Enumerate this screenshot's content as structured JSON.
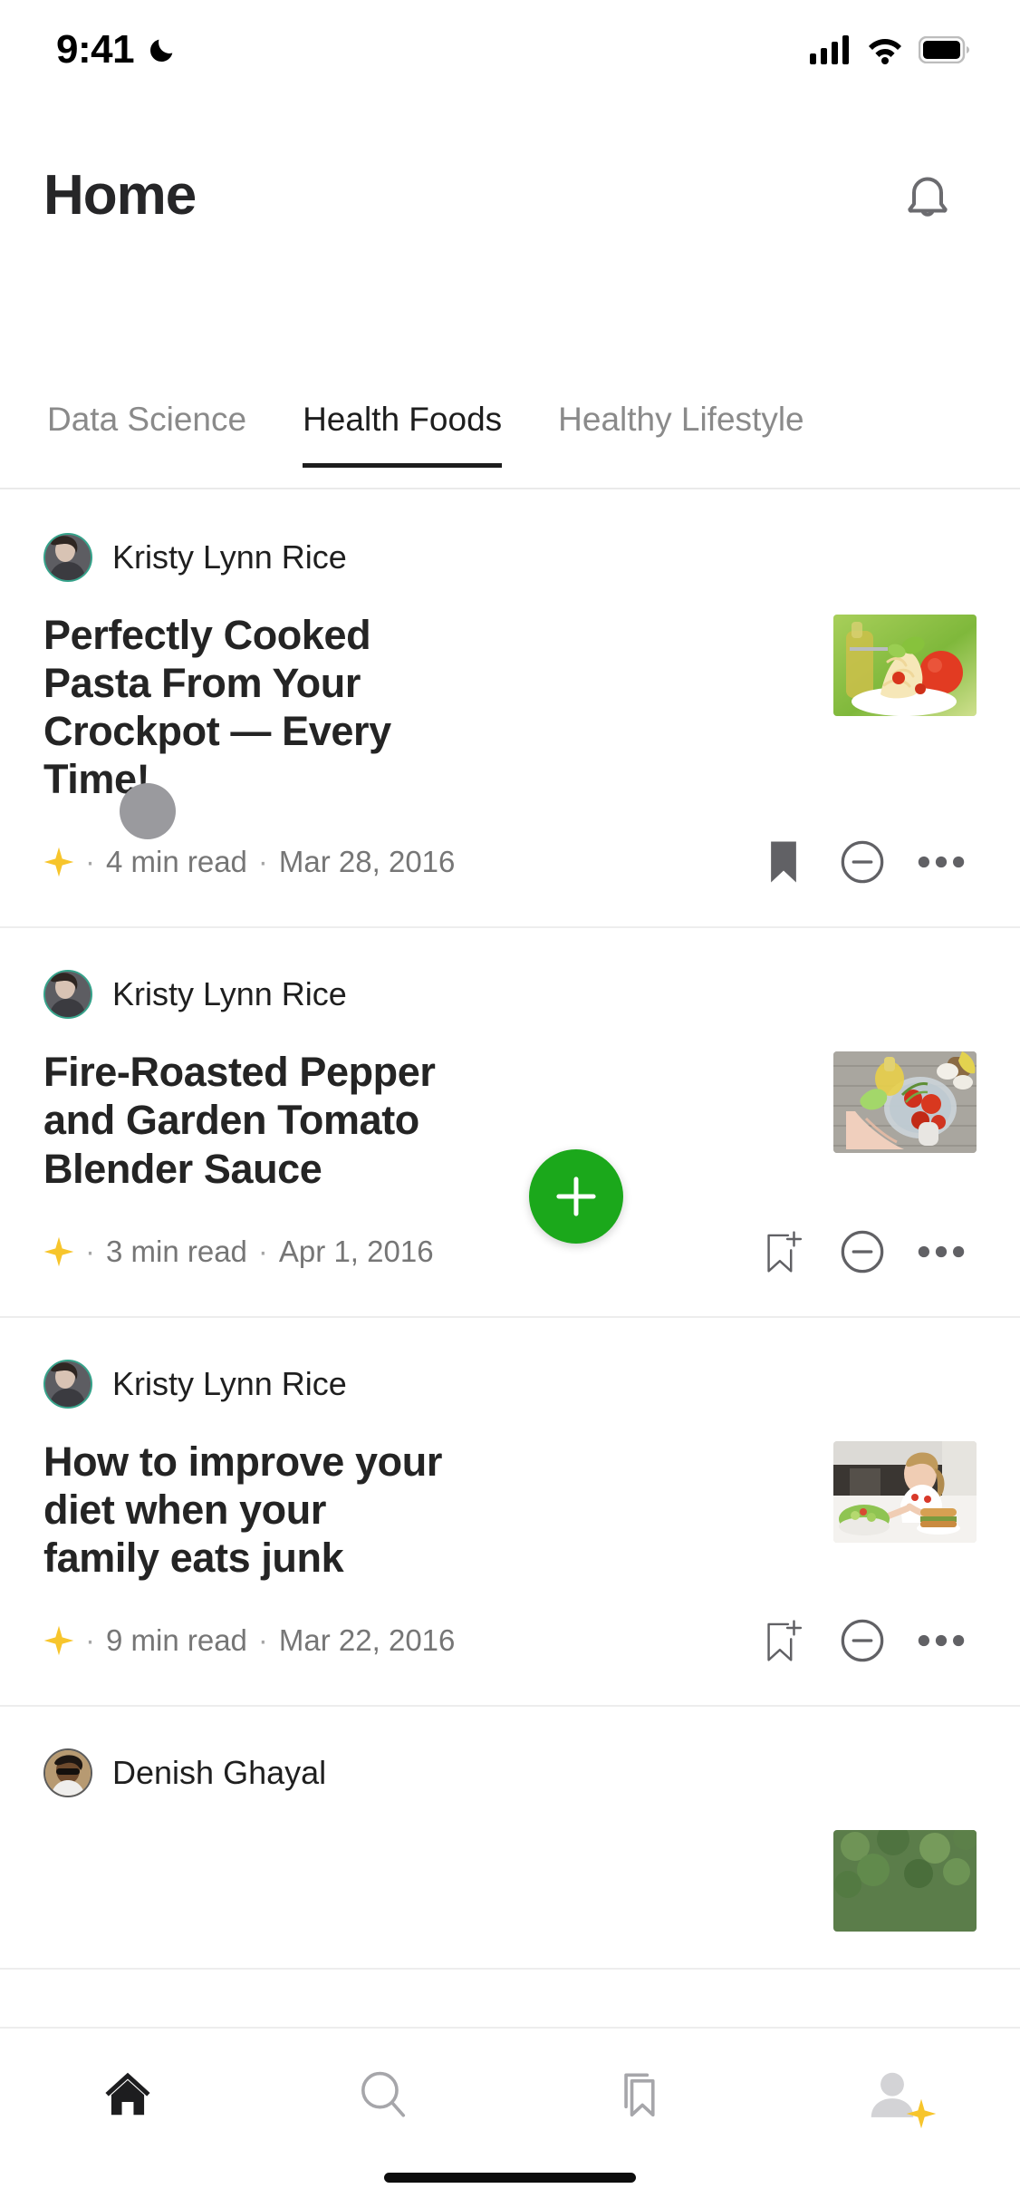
{
  "status_bar": {
    "time": "9:41",
    "dnd_icon": "crescent-moon-icon",
    "signal_icon": "cellular-signal-icon",
    "wifi_icon": "wifi-icon",
    "battery_icon": "battery-full-icon"
  },
  "header": {
    "title": "Home",
    "notification_icon": "bell-icon"
  },
  "tabs": [
    {
      "label": "Data Science",
      "active": false
    },
    {
      "label": "Health Foods",
      "active": true
    },
    {
      "label": "Healthy Lifestyle",
      "active": false
    }
  ],
  "feed": {
    "items": [
      {
        "author": "Kristy Lynn Rice",
        "title": "Perfectly Cooked Pasta From Your Crockpot — Every Time!",
        "member_star": "member-star-icon",
        "read_time": "4  min read",
        "date": "Mar 28, 2016",
        "separator": "·",
        "bookmark_state": "saved",
        "bookmark_icon": "bookmark-filled-icon",
        "hide_icon": "minus-circle-icon",
        "more_icon": "more-horizontal-icon",
        "thumbnail_alt": "pasta-on-fork-thumbnail"
      },
      {
        "author": "Kristy Lynn Rice",
        "title": "Fire-Roasted Pepper and Garden Tomato Blender Sauce",
        "member_star": "member-star-icon",
        "read_time": "3  min read",
        "date": "Apr 1, 2016",
        "separator": "·",
        "bookmark_state": "unsaved",
        "bookmark_icon": "bookmark-add-icon",
        "hide_icon": "minus-circle-icon",
        "more_icon": "more-horizontal-icon",
        "thumbnail_alt": "tomatoes-in-blender-bowl-thumbnail"
      },
      {
        "author": "Kristy Lynn Rice",
        "title": "How to improve your diet when your family eats junk",
        "member_star": "member-star-icon",
        "read_time": "9  min read",
        "date": "Mar 22, 2016",
        "separator": "·",
        "bookmark_state": "unsaved",
        "bookmark_icon": "bookmark-add-icon",
        "hide_icon": "minus-circle-icon",
        "more_icon": "more-horizontal-icon",
        "thumbnail_alt": "girl-with-salad-and-burger-thumbnail"
      },
      {
        "author": "Denish Ghayal",
        "title": "",
        "thumbnail_alt": "greens-thumbnail"
      }
    ]
  },
  "fab": {
    "label": "+",
    "icon": "plus-icon",
    "color": "#1ba81b"
  },
  "bottom_nav": [
    {
      "name": "home",
      "icon": "home-filled-icon",
      "active": true
    },
    {
      "name": "search",
      "icon": "search-icon",
      "active": false
    },
    {
      "name": "library",
      "icon": "bookmarks-icon",
      "active": false
    },
    {
      "name": "profile",
      "icon": "profile-avatar-icon",
      "badge": "member-star-icon",
      "active": false
    }
  ],
  "colors": {
    "accent_green": "#1ba81b",
    "star_yellow": "#f7c52c",
    "text_primary": "#242424",
    "text_muted": "#767676",
    "avatar_ring": "#35a28a"
  }
}
